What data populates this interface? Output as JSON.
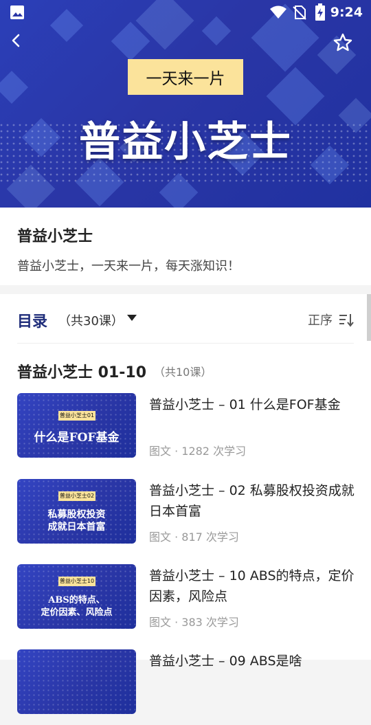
{
  "status_bar": {
    "time": "9:24",
    "icons": [
      "image-icon",
      "wifi-icon",
      "no-sim-icon",
      "battery-charging-icon"
    ]
  },
  "header": {
    "back_icon": "chevron-left-icon",
    "favorite_icon": "star-outline-icon"
  },
  "banner": {
    "tag": "一天来一片",
    "title": "普益小芝士"
  },
  "course": {
    "name": "普益小芝士",
    "description": "普益小芝士，一天来一片，每天涨知识！"
  },
  "toc": {
    "title": "目录",
    "count": "（共30课）",
    "sort_label": "正序"
  },
  "section": {
    "title": "普益小芝士 01-10",
    "count": "（共10课）"
  },
  "lessons": [
    {
      "thumb_label": "普益小芝士01",
      "thumb_title_1": "什么是FOF基金",
      "thumb_title_2": "",
      "title": "普益小芝士 – 01 什么是FOF基金",
      "meta": "图文 · 1282 次学习"
    },
    {
      "thumb_label": "普益小芝士02",
      "thumb_title_1": "私募股权投资",
      "thumb_title_2": "成就日本首富",
      "title": "普益小芝士 – 02 私募股权投资成就日本首富",
      "meta": "图文 · 817 次学习"
    },
    {
      "thumb_label": "普益小芝士10",
      "thumb_title_1": "ABS的特点、",
      "thumb_title_2": "定价因素、风险点",
      "title": "普益小芝士 – 10 ABS的特点，定价因素，风险点",
      "meta": "图文 · 383 次学习"
    },
    {
      "thumb_label": "",
      "thumb_title_1": "",
      "thumb_title_2": "",
      "title": "普益小芝士 – 09 ABS是啥",
      "meta": ""
    }
  ],
  "colors": {
    "banner_blue": "#2a36a6",
    "tag_yellow": "#fbe39b",
    "toc_title": "#1f2d7a"
  }
}
